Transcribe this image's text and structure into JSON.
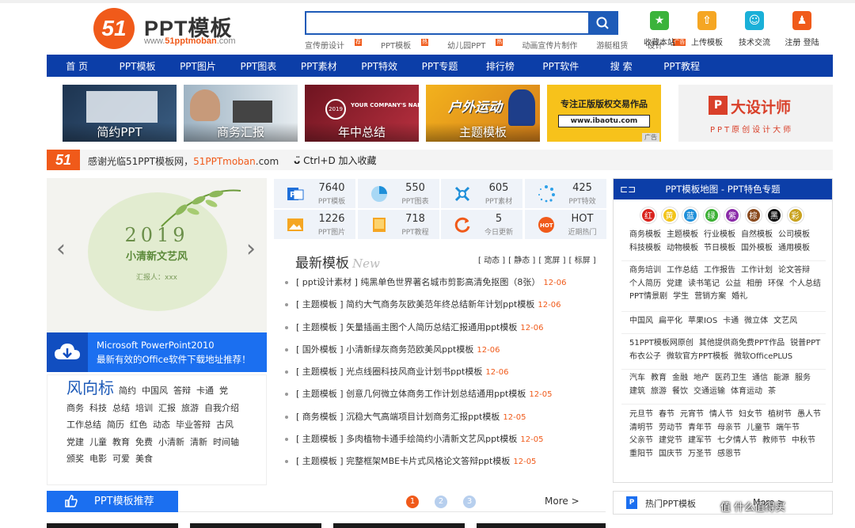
{
  "logo": {
    "mark": "51",
    "title": "PPT模板",
    "url_prefix": "www.",
    "url_brand": "51pptmoban",
    "url_suffix": ".com"
  },
  "search": {
    "value": "",
    "placeholder": ""
  },
  "hotwords": [
    {
      "label": "宣传册设计",
      "badge": "荐"
    },
    {
      "label": "PPT模板",
      "badge": "热"
    },
    {
      "label": "幼儿园PPT",
      "badge": "热"
    },
    {
      "label": "动画宣传片制作",
      "badge": ""
    },
    {
      "label": "游艇租赁",
      "badge": ""
    },
    {
      "label": "设计",
      "badge": "广告"
    }
  ],
  "tools": [
    {
      "label": "收藏本站",
      "icon": "star-icon",
      "color": "#3bb33b"
    },
    {
      "label": "上传模板",
      "icon": "upload-icon",
      "color": "#f5a623"
    },
    {
      "label": "技术交流",
      "icon": "chat-icon",
      "color": "#1ab0d8"
    },
    {
      "label": "注册 登陆",
      "icon": "user-icon",
      "color": "#f05a1a"
    }
  ],
  "nav": [
    "首 页",
    "PPT模板",
    "PPT图片",
    "PPT图表",
    "PPT素材",
    "PPT特效",
    "PPT专题",
    "排行榜",
    "PPT软件",
    "搜 索",
    "PPT教程"
  ],
  "banners": [
    {
      "caption": "简约PPT",
      "color": "#27425e"
    },
    {
      "caption": "商务汇报",
      "color": "#6b8aa3"
    },
    {
      "caption": "年中总结",
      "color": "#8e1c2a",
      "overlay": "YOUR COMPANY'S NAME"
    },
    {
      "caption": "主题模板",
      "color": "#e8a51a",
      "overlay": "户外运动"
    },
    {
      "caption": "",
      "color": "#f7c21b",
      "line1": "专注正版版权交易作品",
      "line2": "www.ibaotu.com",
      "ad": "广告"
    },
    {
      "caption": "",
      "color": "#f2f2f2",
      "brand": "大设计师",
      "sub": "PPT原创设计大师"
    }
  ],
  "welcome": {
    "mark": "51",
    "text": "感谢光临51PPT模板网，",
    "brand": "51PPTmoban",
    "suffix": ".com",
    "fav": "Ctrl+D 加入收藏"
  },
  "slider": {
    "year": "2019",
    "title": "小清新文艺风",
    "name": "汇报人：xxx",
    "prev": "‹",
    "next": "›"
  },
  "promo": {
    "line1": "Microsoft PowerPoint2010",
    "line2": "最新有效的Office软件下载地址推荐！"
  },
  "tags": {
    "first": "风向标",
    "items": [
      "简约",
      "中国风",
      "答辩",
      "卡通",
      "党",
      "商务",
      "科技",
      "总结",
      "培训",
      "汇报",
      "旅游",
      "自我介绍",
      "工作总结",
      "简历",
      "红色",
      "动态",
      "毕业答辩",
      "古风",
      "党建",
      "儿童",
      "教育",
      "免费",
      "小清新",
      "清新",
      "时间轴",
      "颁奖",
      "电影",
      "可爱",
      "美食"
    ]
  },
  "stats": [
    {
      "num": "7640",
      "label": "PPT模板",
      "icon": "ppt-icon",
      "color": "#1e6fd9"
    },
    {
      "num": "550",
      "label": "PPT图表",
      "icon": "pie-chart-icon",
      "color": "#2ea0e8"
    },
    {
      "num": "605",
      "label": "PPT素材",
      "icon": "material-icon",
      "color": "#1e8fd9"
    },
    {
      "num": "425",
      "label": "PPT特效",
      "icon": "effect-icon",
      "color": "#2ea0e8"
    },
    {
      "num": "1226",
      "label": "PPT图片",
      "icon": "image-icon",
      "color": "#f5a623"
    },
    {
      "num": "718",
      "label": "PPT教程",
      "icon": "book-icon",
      "color": "#f5a623"
    },
    {
      "num": "5",
      "label": "今日更新",
      "icon": "refresh-icon",
      "color": "#f05a1a"
    },
    {
      "num": "HOT",
      "label": "近期热门",
      "icon": "hot-icon",
      "color": "#f05a1a"
    }
  ],
  "latest": {
    "title": "最新模板",
    "sub": "New",
    "filters": [
      "[ 动态 ]",
      "[ 静态 ]",
      "[ 宽屏 ]",
      "[ 标屏 ]"
    ],
    "items": [
      {
        "cat": "ppt设计素材",
        "title": "纯黑单色世界著名城市剪影高清免抠图（8张）",
        "date": "12-06"
      },
      {
        "cat": "主题模板",
        "title": "简约大气商务灰欧美范年终总结新年计划ppt模板",
        "date": "12-06"
      },
      {
        "cat": "主题模板",
        "title": "矢量插画主图个人简历总结汇报通用ppt模板",
        "date": "12-06"
      },
      {
        "cat": "国外模板",
        "title": "小清新绿灰商务范欧美风ppt模板",
        "date": "12-06"
      },
      {
        "cat": "主题模板",
        "title": "光点线圈科技风商业计划书ppt模板",
        "date": "12-06"
      },
      {
        "cat": "主题模板",
        "title": "创意几何微立体商务工作计划总结通用ppt模板",
        "date": "12-05"
      },
      {
        "cat": "商务模板",
        "title": "沉稳大气高端项目计划商务汇报ppt模板",
        "date": "12-05"
      },
      {
        "cat": "主题模板",
        "title": "多肉植物卡通手绘简约小清新文艺风ppt模板",
        "date": "12-05"
      },
      {
        "cat": "主题模板",
        "title": "完整框架MBE卡片式风格论文答辩ppt模板",
        "date": "12-05"
      }
    ]
  },
  "map": {
    "title": "PPT模板地图 - PPT特色专题",
    "colors": [
      {
        "label": "红",
        "color": "#d9231d"
      },
      {
        "label": "黄",
        "color": "#f2c41a"
      },
      {
        "label": "蓝",
        "color": "#1e8fd9"
      },
      {
        "label": "绿",
        "color": "#3cb034"
      },
      {
        "label": "紫",
        "color": "#8a2aa8"
      },
      {
        "label": "棕",
        "color": "#8a4a1e"
      },
      {
        "label": "黑",
        "color": "#111111"
      },
      {
        "label": "彩",
        "color": "#c9a21e"
      }
    ],
    "groups": [
      [
        "商务模板",
        "主题模板",
        "行业模板",
        "自然模板",
        "公司模板",
        "科技模板",
        "动物模板",
        "节日模板",
        "国外模板",
        "通用模板"
      ],
      [
        "商务培训",
        "工作总结",
        "工作报告",
        "工作计划",
        "论文答辩",
        "个人简历",
        "党建",
        "读书笔记",
        "公益",
        "相册",
        "环保",
        "个人总结",
        "PPT情景剧",
        "学生",
        "营销方案",
        "婚礼"
      ],
      [
        "中国风",
        "扁平化",
        "苹果IOS",
        "卡通",
        "微立体",
        "文艺风"
      ],
      [
        "51PPT模板网原创",
        "其他提供商免费PPT作品",
        "锐普PPT",
        "布衣公子",
        "微软官方PPT模板",
        "微软OfficePLUS"
      ],
      [
        "汽车",
        "教育",
        "金融",
        "地产",
        "医药卫生",
        "通信",
        "能源",
        "服务",
        "建筑",
        "旅游",
        "餐饮",
        "交通运输",
        "体育运动",
        "茶"
      ],
      [
        "元旦节",
        "春节",
        "元宵节",
        "情人节",
        "妇女节",
        "植树节",
        "愚人节",
        "清明节",
        "劳动节",
        "青年节",
        "母亲节",
        "儿童节",
        "端午节",
        "父亲节",
        "建党节",
        "建军节",
        "七夕情人节",
        "教师节",
        "中秋节",
        "重阳节",
        "国庆节",
        "万圣节",
        "感恩节"
      ]
    ]
  },
  "recommend": {
    "title": "PPT模板推荐",
    "pages": [
      "1",
      "2",
      "3"
    ],
    "more": "More >"
  },
  "hot": {
    "title": "热门PPT模板",
    "more": "More >"
  },
  "watermark": "值 什么值得买"
}
